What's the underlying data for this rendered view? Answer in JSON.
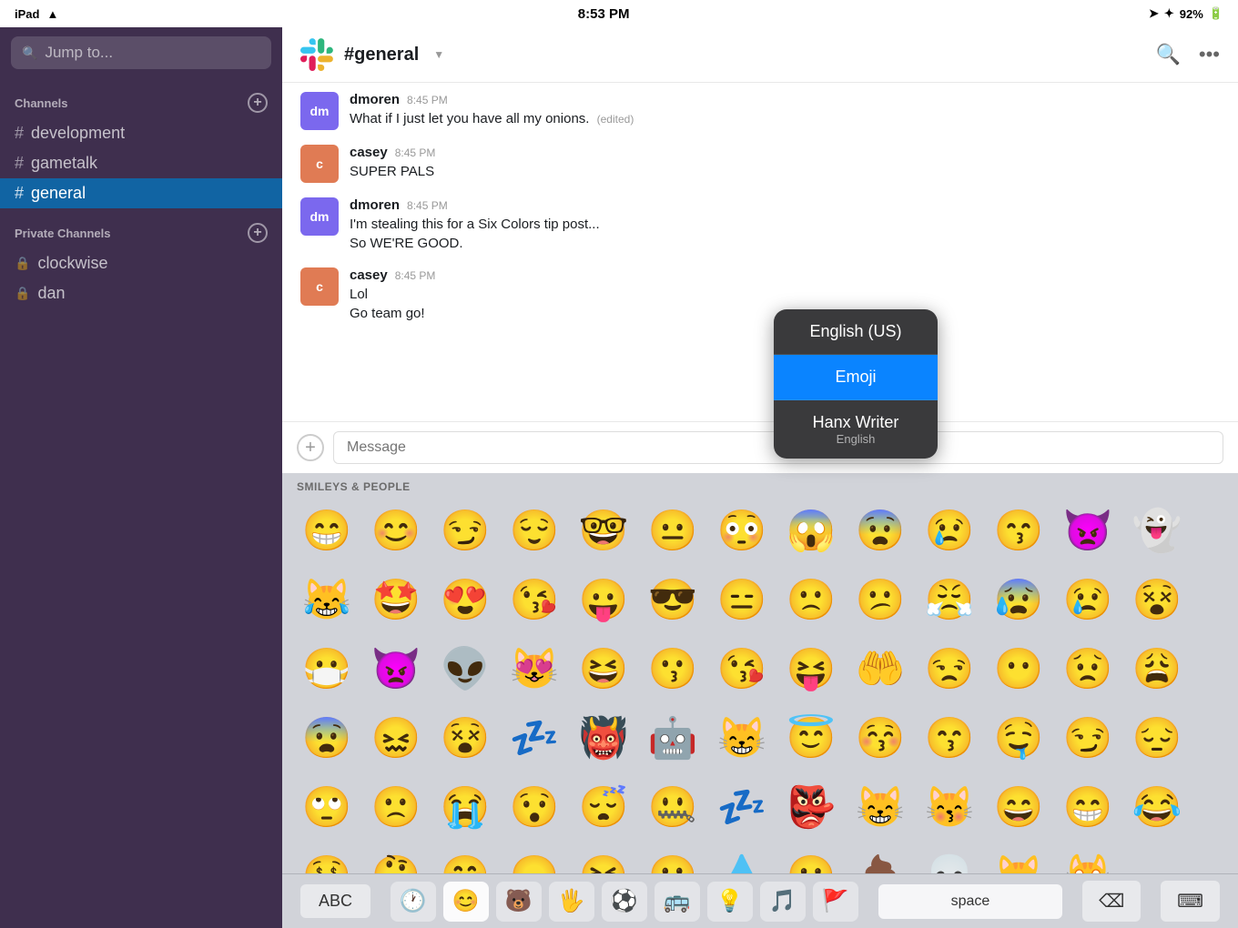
{
  "statusBar": {
    "left": "iPad ✦ ✦",
    "time": "8:53 PM",
    "right": "92%"
  },
  "sidebar": {
    "searchPlaceholder": "Jump to...",
    "channelsLabel": "Channels",
    "privateChannelsLabel": "Private Channels",
    "channels": [
      {
        "name": "development",
        "type": "public",
        "active": false
      },
      {
        "name": "gametalk",
        "type": "public",
        "active": false
      },
      {
        "name": "general",
        "type": "public",
        "active": true
      }
    ],
    "privateChannels": [
      {
        "name": "clockwise",
        "type": "private",
        "active": false
      },
      {
        "name": "dan",
        "type": "private",
        "active": false
      }
    ]
  },
  "chat": {
    "channelName": "#general",
    "messages": [
      {
        "author": "dmoren",
        "time": "8:45 PM",
        "text": "What if I just let you have all my onions.",
        "edited": true
      },
      {
        "author": "casey",
        "time": "8:45 PM",
        "text": "SUPER PALS",
        "edited": false
      },
      {
        "author": "dmoren",
        "time": "8:45 PM",
        "text": "I'm stealing this for a Six Colors tip post...\nSo WE'RE GOOD.",
        "edited": false
      },
      {
        "author": "casey",
        "time": "8:45 PM",
        "text": "Lol\nGo team go!",
        "edited": false
      }
    ],
    "inputPlaceholder": "Message"
  },
  "emojiKeyboard": {
    "sectionLabel": "SMILEYS & PEOPLE",
    "emojis": [
      "😁",
      "😊",
      "😏",
      "😌",
      "🤓",
      "😐",
      "😳",
      "😱",
      "😨",
      "😢",
      "😙",
      "👿",
      "👻",
      "😹",
      "🤩",
      "😍",
      "😘",
      "😛",
      "😎",
      "😑",
      "🙁",
      "😕",
      "😤",
      "😰",
      "😢",
      "😵",
      "😷",
      "👿",
      "👽",
      "😻",
      "😆",
      "😗",
      "😘",
      "😝",
      "🤲",
      "😒",
      "😶",
      "😟",
      "😩",
      "😨",
      "😖",
      "😵",
      "💤",
      "👹",
      "🤖",
      "😸",
      "😇",
      "😚",
      "😙",
      "🤤",
      "😏",
      "😔",
      "🙄",
      "🙁",
      "😭",
      "😯",
      "😴",
      "🤐",
      "💤",
      "👺",
      "😸",
      "😽",
      "😄",
      "😁",
      "😂",
      "🤑",
      "🤔",
      "🤭",
      "😠",
      "😆",
      "😮",
      "💧",
      "😷",
      "💩",
      "💀",
      "😺",
      "🙀"
    ],
    "languagePicker": {
      "options": [
        {
          "label": "English (US)",
          "sublabel": "",
          "selected": false
        },
        {
          "label": "Emoji",
          "sublabel": "",
          "selected": true
        },
        {
          "label": "Hanx Writer",
          "sublabel": "English",
          "selected": false
        }
      ]
    },
    "bottomBar": {
      "abc": "ABC",
      "space": "space",
      "icons": [
        "🕐",
        "😊",
        "🐻",
        "🖐",
        "⚽",
        "🚌",
        "💡",
        "🎵",
        "🚩"
      ]
    }
  }
}
